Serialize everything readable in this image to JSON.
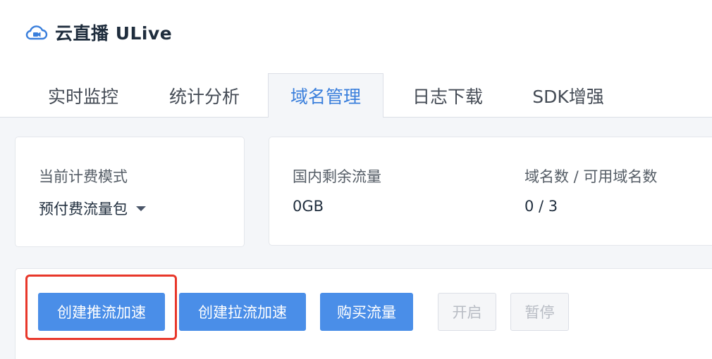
{
  "header": {
    "icon": "cloud-camera-icon",
    "title": "云直播 ULive"
  },
  "tabs": [
    {
      "label": "实时监控",
      "active": false
    },
    {
      "label": "统计分析",
      "active": false
    },
    {
      "label": "域名管理",
      "active": true
    },
    {
      "label": "日志下载",
      "active": false
    },
    {
      "label": "SDK增强",
      "active": false
    }
  ],
  "billing": {
    "label": "当前计费模式",
    "value": "预付费流量包"
  },
  "stats": {
    "traffic_label": "国内剩余流量",
    "traffic_value": "0GB",
    "domains_label": "域名数 / 可用域名数",
    "domains_value": "0 / 3"
  },
  "actions": {
    "create_push": "创建推流加速",
    "create_pull": "创建拉流加速",
    "buy_traffic": "购买流量",
    "enable": "开启",
    "pause": "暂停"
  },
  "colors": {
    "accent": "#4a8ee8",
    "active_tab_text": "#3a7fdc",
    "highlight": "#e8372a"
  }
}
